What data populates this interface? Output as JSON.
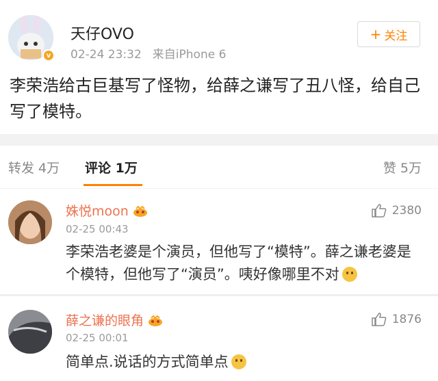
{
  "post": {
    "username": "天仔OVO",
    "time": "02-24 23:32",
    "source": "来自iPhone 6",
    "follow_label": "关注",
    "text": "李荣浩给古巨基写了怪物，给薛之谦写了丑八怪，给自己写了模特。"
  },
  "tabs": {
    "repost": "转发 4万",
    "comment": "评论 1万",
    "like": "赞 5万"
  },
  "comments": [
    {
      "name": "姝悦moon",
      "time": "02-25 00:43",
      "likes": "2380",
      "text": "李荣浩老婆是个演员，但他写了“模特”。薛之谦老婆是个模特，但他写了“演员”。咦好像哪里不对"
    },
    {
      "name": "薛之谦的眼角",
      "time": "02-25 00:01",
      "likes": "1876",
      "text": "简单点.说话的方式简单点"
    }
  ],
  "colors": {
    "accent": "#ff8200",
    "name": "#eb7350",
    "badge": "#f5a623"
  }
}
